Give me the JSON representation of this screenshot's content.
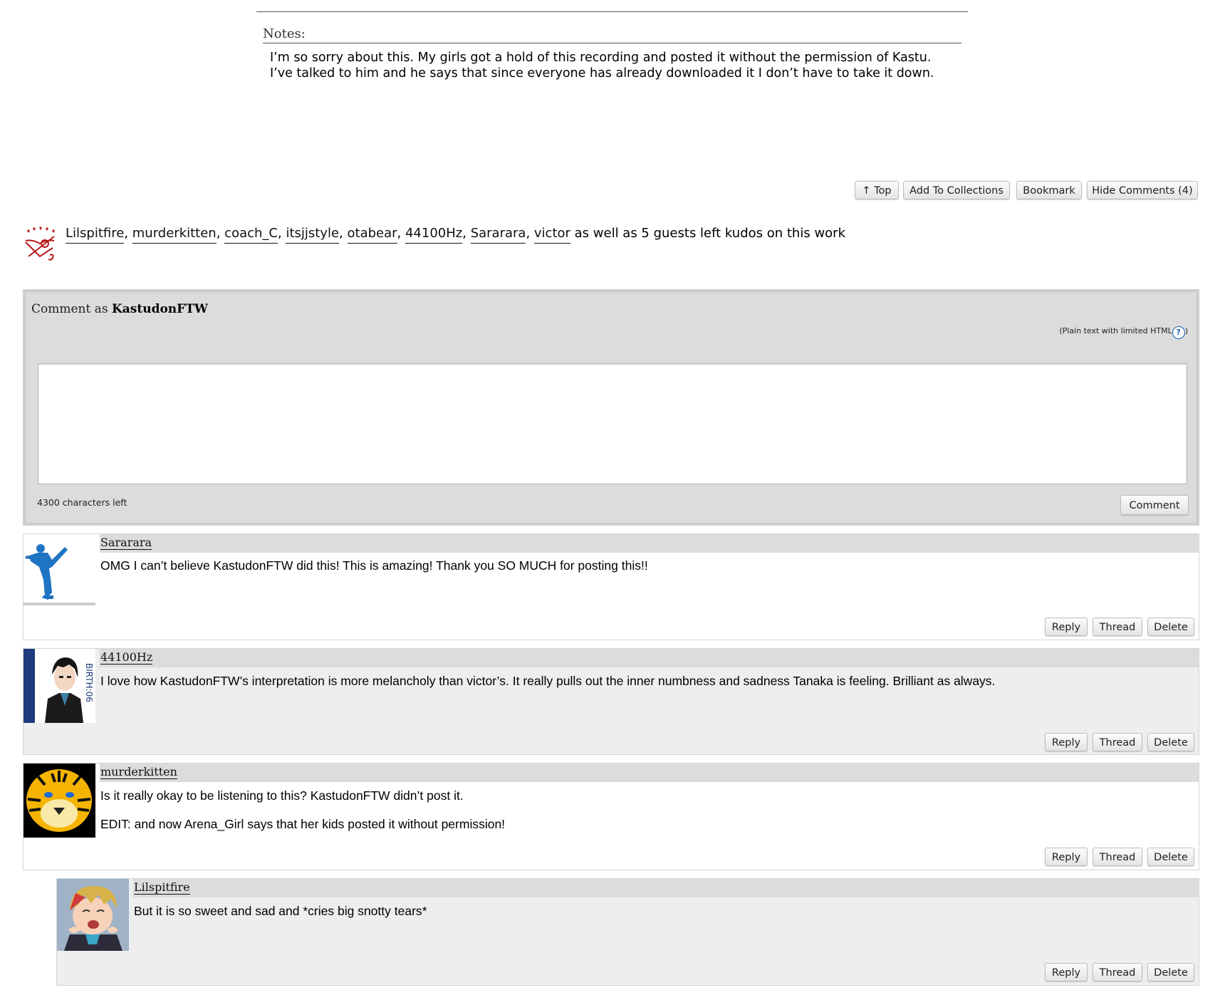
{
  "notes": {
    "heading": "Notes:",
    "body": "I’m so sorry about this. My girls got a hold of this recording and posted it without the permission of Kastu. I’ve talked to him and he says that since everyone has already downloaded it I don’t have to take it down."
  },
  "nav": {
    "top": "↑ Top",
    "add_to_collections": "Add To Collections",
    "bookmark": "Bookmark",
    "hide_comments": "Hide Comments (4)"
  },
  "kudos": {
    "users": [
      "Lilspitfire",
      "murderkitten",
      "coach_C",
      "itsjjstyle",
      "otabear",
      "44100Hz",
      "Sararara",
      "victor"
    ],
    "suffix": " as well as 5 guests left kudos on this work"
  },
  "comment_form": {
    "label": "Comment as",
    "username": "KastudonFTW",
    "format_note": "(Plain text with limited HTML",
    "format_note_close": ")",
    "help": "?",
    "chars_left": "4300 characters left",
    "submit": "Comment"
  },
  "comments": [
    {
      "user": "Sararara",
      "lines": [
        "OMG I can’t believe KastudonFTW did this! This is amazing! Thank you SO MUCH for posting this!!"
      ],
      "actions": [
        "Reply",
        "Thread",
        "Delete"
      ],
      "avatar_icon": "figure-skater-silhouette"
    },
    {
      "user": "44100Hz",
      "lines": [
        "I love how KastudonFTW’s interpretation is more melancholy than victor’s.  It really pulls out the inner numbness and sadness Tanaka is feeling.  Brilliant as always."
      ],
      "actions": [
        "Reply",
        "Thread",
        "Delete"
      ],
      "avatar_icon": "anime-character"
    },
    {
      "user": "murderkitten",
      "lines": [
        "Is it really okay to be listening to this? KastudonFTW didn’t post it.",
        "EDIT: and now Arena_Girl says that her kids posted it without permission!"
      ],
      "actions": [
        "Reply",
        "Thread",
        "Delete"
      ],
      "avatar_icon": "tiger-face"
    },
    {
      "user": "Lilspitfire",
      "lines": [
        "But it is so sweet and sad and *cries big snotty tears*"
      ],
      "actions": [
        "Reply",
        "Thread",
        "Delete"
      ],
      "avatar_icon": "crying-anime-character"
    }
  ],
  "colors": {
    "form_bg": "#dcdcdc",
    "comment_alt_bg": "#eeeeee",
    "kudos_icon": "#b81818",
    "link": "#111111"
  }
}
